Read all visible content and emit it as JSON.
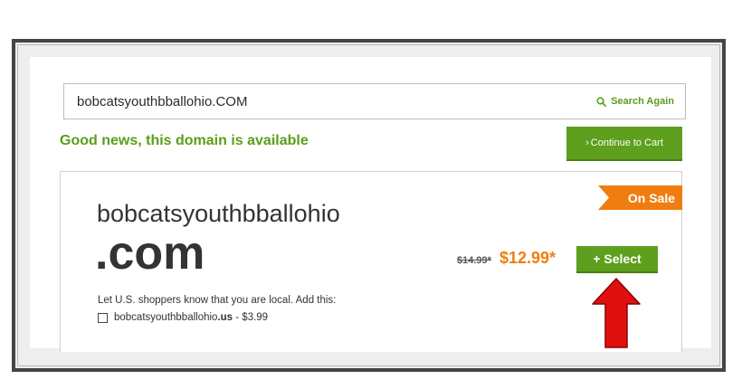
{
  "search": {
    "value": "bobcatsyouthbballohio.COM",
    "action_label": "Search Again",
    "action_icon": "search-icon"
  },
  "status": {
    "message": "Good news, this domain is available"
  },
  "continue_button": {
    "label": "Continue to Cart",
    "icon": "chevron-right-icon"
  },
  "result": {
    "badge": "On Sale",
    "domain_name": "bobcatsyouthbballohio",
    "tld": ".com",
    "old_price": "$14.99*",
    "sale_price": "$12.99*",
    "select_label": "+ Select",
    "local_prompt": "Let U.S. shoppers know that you are local. Add this:",
    "addon": {
      "domain_prefix": "bobcatsyouthbballohio",
      "domain_tld": ".us",
      "price_suffix": " - $3.99",
      "checked": false
    }
  },
  "colors": {
    "accent_green": "#5e9f1e",
    "sale_orange": "#f07d10",
    "annotation_arrow": "#e01010"
  },
  "annotation": {
    "icon": "arrow-up-icon"
  }
}
